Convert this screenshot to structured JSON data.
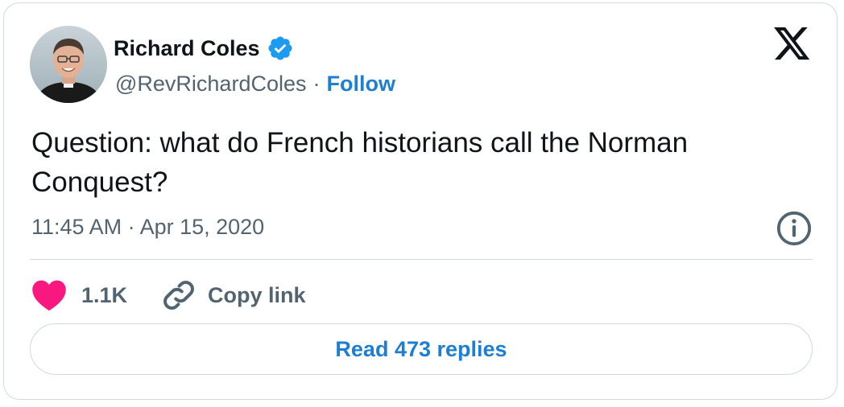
{
  "author": {
    "display_name": "Richard Coles",
    "handle": "@RevRichardColes",
    "separator": "·",
    "follow_label": "Follow",
    "verified": true,
    "avatar_icon": "profile-photo"
  },
  "tweet": {
    "text": "Question: what do French historians call the Norman Conquest?",
    "timestamp": "11:45 AM · Apr 15, 2020"
  },
  "actions": {
    "like_count": "1.1K",
    "copy_link_label": "Copy link",
    "read_replies_label": "Read 473 replies"
  },
  "icons": {
    "brand": "x-logo-icon",
    "verified": "verified-badge-icon",
    "info": "info-icon",
    "like": "heart-icon",
    "copy": "link-icon"
  },
  "colors": {
    "accent": "#1d7fd4",
    "verified_blue": "#1d9bf0",
    "like_pink": "#f91880",
    "secondary_text": "#536471",
    "border": "#cfd9de"
  }
}
